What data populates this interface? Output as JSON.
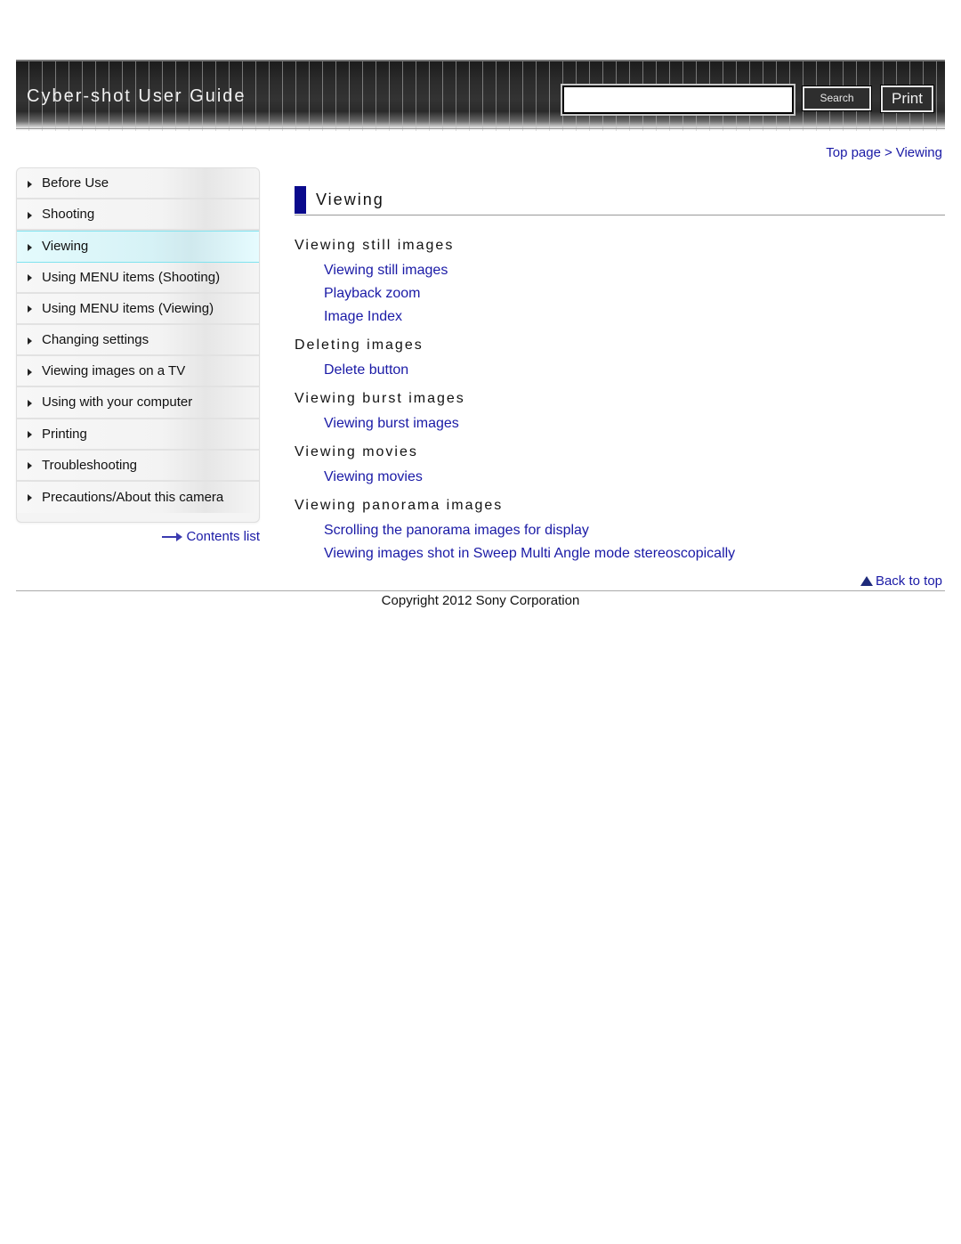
{
  "header": {
    "title": "Cyber-shot User Guide",
    "search": {
      "value": "",
      "placeholder": ""
    },
    "search_button": "Search",
    "print_button": "Print"
  },
  "breadcrumb": {
    "items": [
      "Top page",
      "Viewing"
    ],
    "separator": ">"
  },
  "sidebar": {
    "items": [
      {
        "label": "Before Use",
        "active": false
      },
      {
        "label": "Shooting",
        "active": false
      },
      {
        "label": "Viewing",
        "active": true
      },
      {
        "label": "Using MENU items (Shooting)",
        "active": false
      },
      {
        "label": "Using MENU items (Viewing)",
        "active": false
      },
      {
        "label": "Changing settings",
        "active": false
      },
      {
        "label": "Viewing images on a TV",
        "active": false
      },
      {
        "label": "Using with your computer",
        "active": false
      },
      {
        "label": "Printing",
        "active": false
      },
      {
        "label": "Troubleshooting",
        "active": false
      },
      {
        "label": "Precautions/About this camera",
        "active": false
      }
    ],
    "contents_link": "Contents list"
  },
  "main": {
    "heading": "Viewing",
    "sections": [
      {
        "title": "Viewing still images",
        "links": [
          "Viewing still images",
          "Playback zoom",
          "Image Index"
        ]
      },
      {
        "title": "Deleting images",
        "links": [
          "Delete button"
        ]
      },
      {
        "title": "Viewing burst images",
        "links": [
          "Viewing burst images"
        ]
      },
      {
        "title": "Viewing movies",
        "links": [
          "Viewing movies"
        ]
      },
      {
        "title": "Viewing panorama images",
        "links": [
          "Scrolling the panorama images for display",
          "Viewing images shot in Sweep Multi Angle mode stereoscopically"
        ]
      }
    ]
  },
  "footer": {
    "back_to_top": "Back to top",
    "copyright": "Copyright 2012 Sony Corporation"
  },
  "colors": {
    "link": "#1a1aa6",
    "heading_bar": "#0a0a8c",
    "active_nav_border": "#7fe3ef",
    "banner_bg": "#2c2c2c"
  }
}
